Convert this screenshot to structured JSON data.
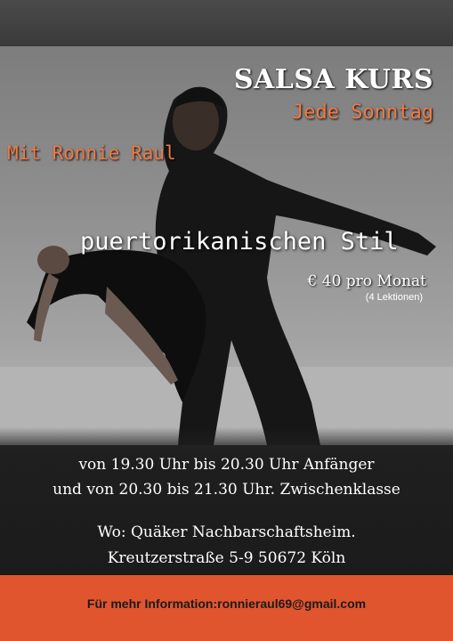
{
  "poster": {
    "title": "SALSA KURS",
    "subtitle": "Jede Sonntag",
    "teacher": "Mit Ronnie Raul",
    "style": "puertorikanischen Stil",
    "price": "€ 40 pro Monat",
    "lessons": "(4 Lektionen)",
    "schedule_line1": "von 19.30 Uhr bis 20.30 Uhr Anfänger",
    "schedule_line2": "und von 20.30 bis 21.30 Uhr. Zwischenklasse",
    "location_line1": "Wo: Quäker Nachbarschaftsheim.",
    "location_line2": "Kreutzerstraße 5-9 50672 Köln",
    "contact": "Für mehr Information:ronnieraul69@gmail.com"
  },
  "colors": {
    "accent_orange": "#e0552e",
    "text_orange": "#f07a45",
    "dark": "#1b1b1b"
  }
}
